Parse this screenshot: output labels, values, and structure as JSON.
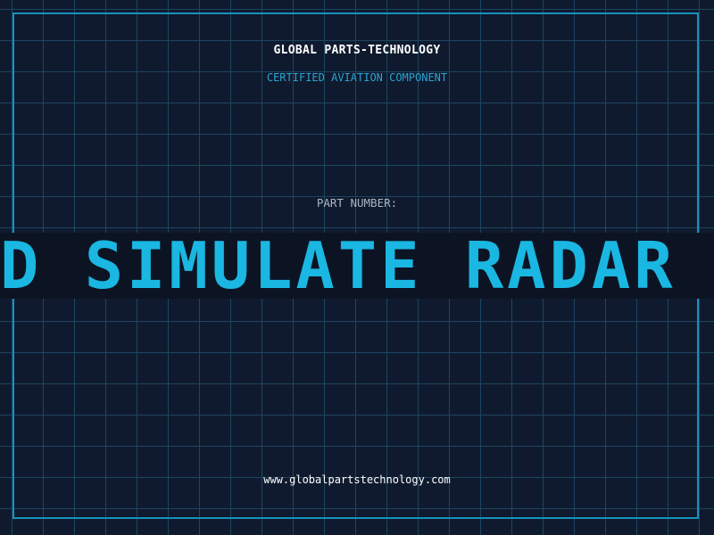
{
  "header": {
    "company": "GLOBAL PARTS-TECHNOLOGY",
    "subtitle": "CERTIFIED AVIATION COMPONENT"
  },
  "part": {
    "label": "PART NUMBER:",
    "value": "D SIMULATE RADAR SY"
  },
  "footer": {
    "website": "www.globalpartstechnology.com"
  },
  "colors": {
    "background": "#101a2e",
    "grid": "#1c4660",
    "frame": "#1592bd",
    "accent": "#1ab7e2",
    "band": "#0c1424"
  }
}
